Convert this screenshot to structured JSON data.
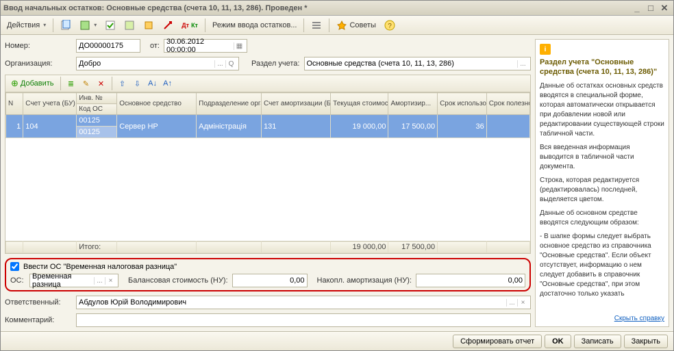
{
  "title": "Ввод начальных остатков: Основные средства (счета 10, 11, 13, 286). Проведен *",
  "toolbar": {
    "actions": "Действия",
    "mode": "Режим ввода остатков...",
    "tips": "Советы"
  },
  "header": {
    "number_label": "Номер:",
    "number": "ДО00000175",
    "date_label": "от:",
    "date": "30.06.2012 00:00:00",
    "org_label": "Организация:",
    "org": "Добро",
    "section_label": "Раздел учета:",
    "section": "Основные средства (счета 10, 11, 13, 286)"
  },
  "table_toolbar": {
    "add": "Добавить"
  },
  "grid": {
    "headers": {
      "n": "N",
      "acct": "Счет учета (БУ)",
      "inv": "Инв. №",
      "code": "Код ОС",
      "asset": "Основное средство",
      "dept": "Подразделение организации",
      "amort_acct": "Счет амортизации (БУ)",
      "cost": "Текущая стоимость ...",
      "amort": "Амортизир...",
      "life": "Срок использов...",
      "useful": "Срок полезно..."
    },
    "row": {
      "n": "1",
      "acct": "104",
      "inv": "00125",
      "code": "00125",
      "asset": "Сервер HP",
      "dept": "Адміністрація",
      "amort_acct": "131",
      "cost": "19 000,00",
      "amort": "17 500,00",
      "life": "36",
      "useful": ""
    },
    "totals": {
      "label": "Итого:",
      "cost": "19 000,00",
      "amort": "17 500,00"
    }
  },
  "redbox": {
    "checkbox": "Ввести ОС \"Временная налоговая разница\"",
    "os_label": "ОС:",
    "os_value": "Временная разница",
    "bal_label": "Балансовая стоимость (НУ):",
    "bal_value": "0,00",
    "nak_label": "Накопл.  амортизация (НУ):",
    "nak_value": "0,00"
  },
  "footer": {
    "resp_label": "Ответственный:",
    "resp": "Абдулов Юрій Володимирович",
    "comment_label": "Комментарий:",
    "comment": ""
  },
  "buttons": {
    "report": "Сформировать отчет",
    "ok": "OK",
    "save": "Записать",
    "close": "Закрыть"
  },
  "help": {
    "title": "Раздел учета \"Основные средства (счета 10, 11, 13, 286)\"",
    "p1": "Данные об остатках основных средств вводятся в специальной форме, которая автоматически открывается при добавлении новой или редактировании существующей строки табличной части.",
    "p2": "Вся введенная информация выводится в табличной части документа.",
    "p3": "Строка, которая редактируется (редактировалась) последней, выделяется цветом.",
    "p4": "Данные об основном средстве вводятся следующим образом:",
    "p5": "- В шапке формы следует выбрать основное средство из справочника \"Основные средства\". Если объект отсутствует, информацию о нем следует добавить в справочник \"Основные средства\", при этом достаточно только указать",
    "hide": "Скрыть справку"
  }
}
